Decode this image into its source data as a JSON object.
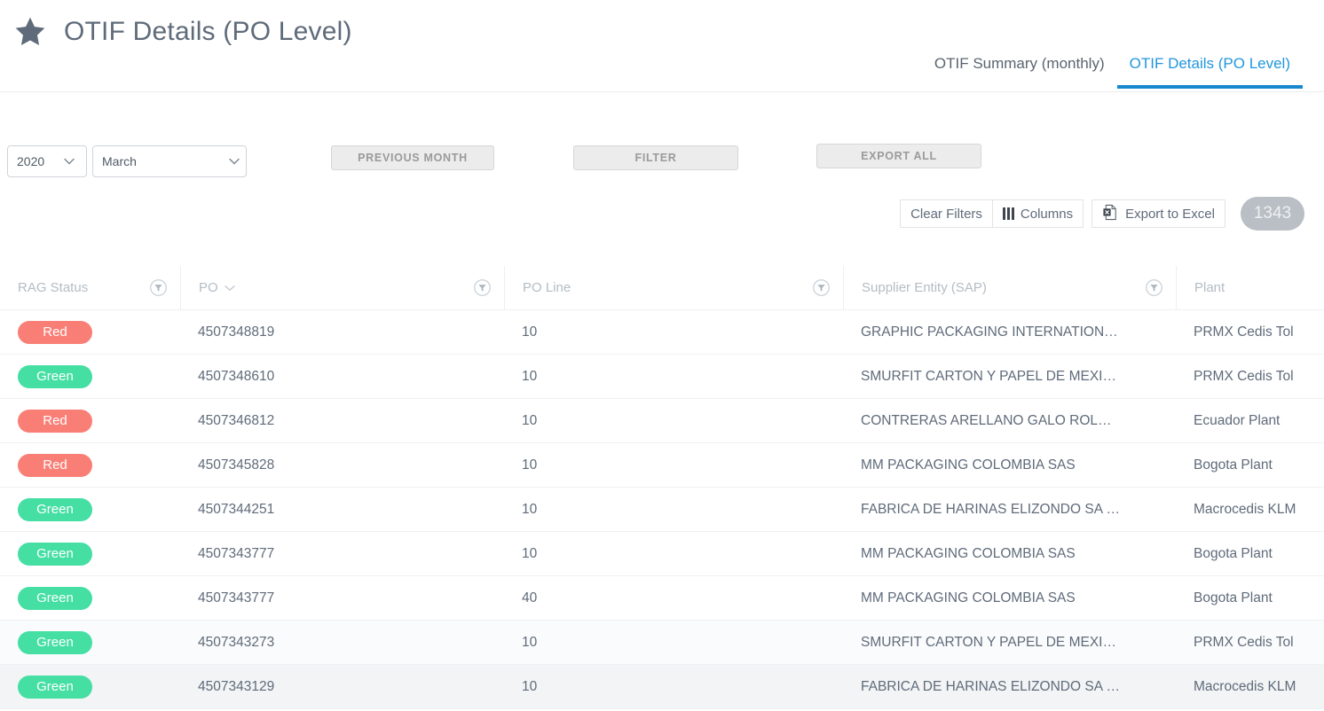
{
  "header": {
    "title": "OTIF Details (PO Level)",
    "star_icon": "star-icon"
  },
  "tabs": [
    {
      "label": "OTIF Summary (monthly)",
      "active": false
    },
    {
      "label": "OTIF Details (PO Level)",
      "active": true
    }
  ],
  "controls": {
    "year_value": "2020",
    "month_value": "March",
    "year_options": [
      "2020"
    ],
    "month_options": [
      "March"
    ],
    "previous_month_label": "PREVIOUS MONTH",
    "filter_label": "FILTER",
    "export_all_label": "EXPORT ALL"
  },
  "grid_toolbar": {
    "clear_filters_label": "Clear Filters",
    "columns_label": "Columns",
    "export_excel_label": "Export to Excel",
    "record_count": "1343"
  },
  "table": {
    "columns": [
      {
        "label": "RAG Status",
        "has_filter": true,
        "sorted": false
      },
      {
        "label": "PO",
        "has_filter": true,
        "sorted": true
      },
      {
        "label": "PO Line",
        "has_filter": true,
        "sorted": false
      },
      {
        "label": "Supplier Entity (SAP)",
        "has_filter": true,
        "sorted": false
      },
      {
        "label": "Plant",
        "has_filter": false,
        "sorted": false
      }
    ],
    "rows": [
      {
        "rag": "Red",
        "po": "4507348819",
        "po_line": "10",
        "supplier": "GRAPHIC PACKAGING INTERNATION…",
        "plant": "PRMX Cedis Tol"
      },
      {
        "rag": "Green",
        "po": "4507348610",
        "po_line": "10",
        "supplier": "SMURFIT CARTON Y PAPEL DE MEXI…",
        "plant": "PRMX Cedis Tol"
      },
      {
        "rag": "Red",
        "po": "4507346812",
        "po_line": "10",
        "supplier": "CONTRERAS ARELLANO GALO ROL…",
        "plant": "Ecuador Plant"
      },
      {
        "rag": "Red",
        "po": "4507345828",
        "po_line": "10",
        "supplier": "MM PACKAGING COLOMBIA SAS",
        "plant": "Bogota Plant"
      },
      {
        "rag": "Green",
        "po": "4507344251",
        "po_line": "10",
        "supplier": "FABRICA DE HARINAS ELIZONDO SA …",
        "plant": "Macrocedis KLM"
      },
      {
        "rag": "Green",
        "po": "4507343777",
        "po_line": "10",
        "supplier": "MM PACKAGING COLOMBIA SAS",
        "plant": "Bogota Plant"
      },
      {
        "rag": "Green",
        "po": "4507343777",
        "po_line": "40",
        "supplier": "MM PACKAGING COLOMBIA SAS",
        "plant": "Bogota Plant"
      },
      {
        "rag": "Green",
        "po": "4507343273",
        "po_line": "10",
        "supplier": "SMURFIT CARTON Y PAPEL DE MEXI…",
        "plant": "PRMX Cedis Tol"
      },
      {
        "rag": "Green",
        "po": "4507343129",
        "po_line": "10",
        "supplier": "FABRICA DE HARINAS ELIZONDO SA …",
        "plant": "Macrocedis KLM"
      }
    ]
  },
  "colors": {
    "accent_blue": "#1787ce",
    "rag_red": "#f97f76",
    "rag_green": "#45dfa4",
    "badge_gray": "#b9bfc4",
    "text_gray": "#5f6b7a"
  }
}
